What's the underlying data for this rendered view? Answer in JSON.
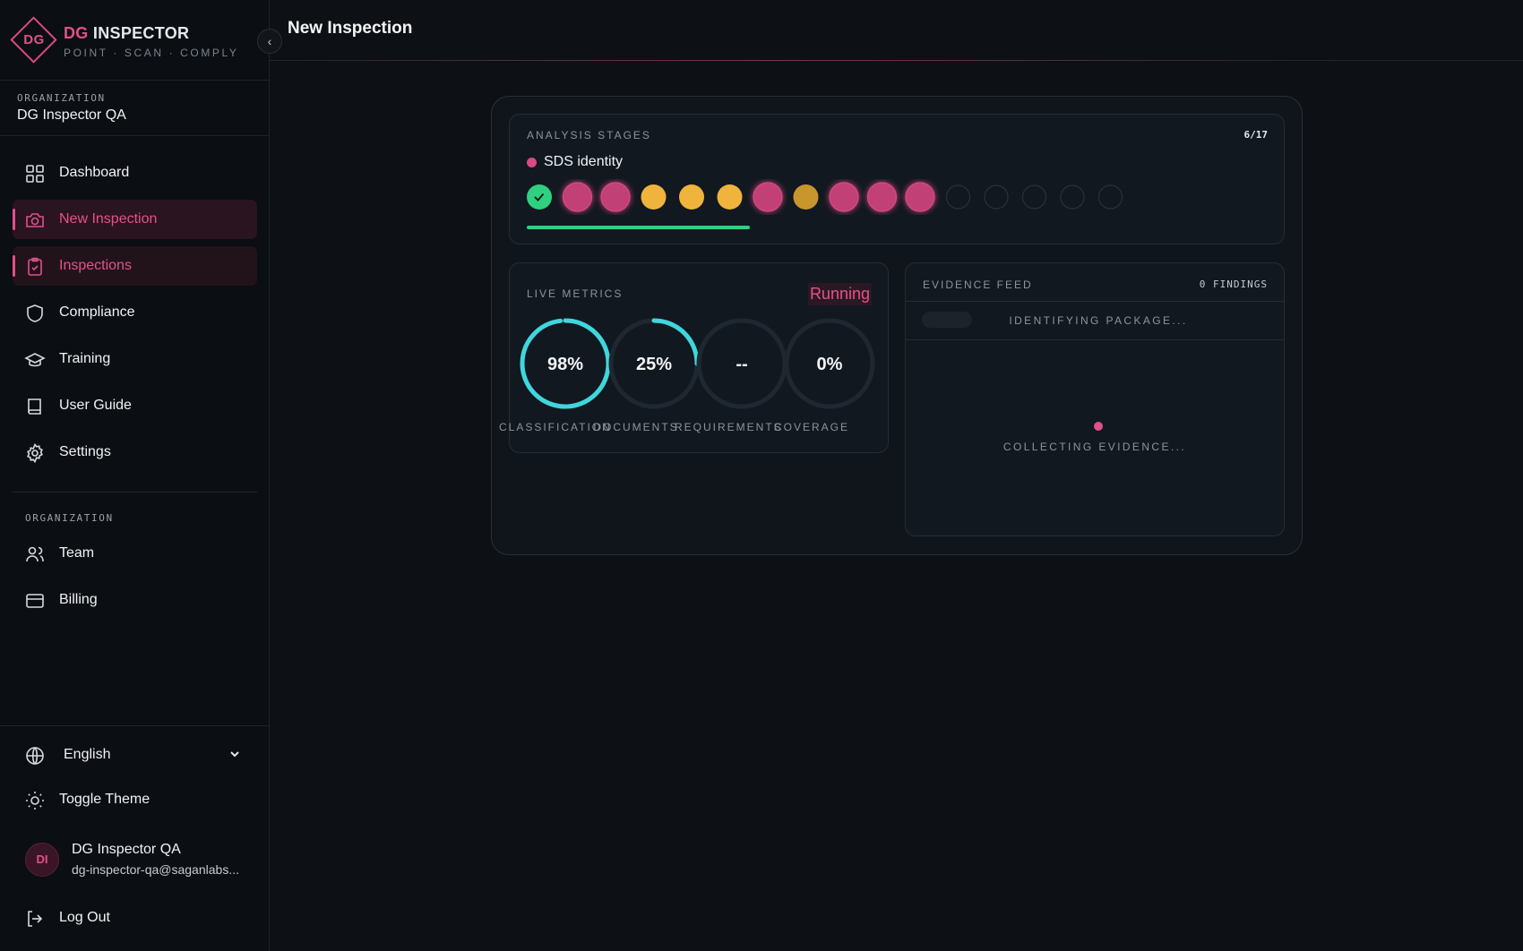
{
  "brand": {
    "logo_text": "DG",
    "title_accent": "DG",
    "title_rest": " INSPECTOR",
    "tagline": "POINT · SCAN · COMPLY"
  },
  "sidebar": {
    "organization_label": "ORGANIZATION",
    "organization_name": "DG Inspector QA",
    "items": [
      {
        "label": "Dashboard",
        "icon": "grid-icon",
        "active": false
      },
      {
        "label": "New Inspection",
        "icon": "camera-icon",
        "active": true
      },
      {
        "label": "Inspections",
        "icon": "clipboard-check-icon",
        "active": true
      },
      {
        "label": "Compliance",
        "icon": "shield-icon",
        "active": false
      },
      {
        "label": "Training",
        "icon": "graduation-cap-icon",
        "active": false
      },
      {
        "label": "User Guide",
        "icon": "book-icon",
        "active": false
      },
      {
        "label": "Settings",
        "icon": "gear-icon",
        "active": false
      }
    ],
    "org_section_label": "ORGANIZATION",
    "org_items": [
      {
        "label": "Team",
        "icon": "users-icon"
      },
      {
        "label": "Billing",
        "icon": "credit-card-icon"
      }
    ],
    "language": "English",
    "toggle_theme": "Toggle Theme",
    "user": {
      "initials": "DI",
      "name": "DG Inspector QA",
      "email": "dg-inspector-qa@saganlabs..."
    },
    "logout": "Log Out"
  },
  "header": {
    "title": "New Inspection"
  },
  "analysis": {
    "label": "ANALYSIS STAGES",
    "count": "6/17",
    "current_stage": "SDS identity",
    "progress": 0.353,
    "stages": [
      "done",
      "active",
      "active",
      "warn",
      "warn",
      "warn",
      "active",
      "warn-dim",
      "active",
      "active",
      "active",
      "pending",
      "pending",
      "pending",
      "pending",
      "pending"
    ]
  },
  "metrics": {
    "label": "LIVE METRICS",
    "status": "Running",
    "gauges": [
      {
        "value_text": "98%",
        "label": "CLASSIFICATION",
        "fraction": 0.98
      },
      {
        "value_text": "25%",
        "label": "DOCUMENTS",
        "fraction": 0.25
      },
      {
        "value_text": "--",
        "label": "REQUIREMENTS",
        "fraction": 0
      },
      {
        "value_text": "0%",
        "label": "COVERAGE",
        "fraction": 0
      }
    ]
  },
  "evidence": {
    "label": "EVIDENCE FEED",
    "findings": "0 FINDINGS",
    "status": "IDENTIFYING PACKAGE...",
    "empty_text": "COLLECTING EVIDENCE..."
  },
  "colors": {
    "accent": "#e0508c",
    "success": "#2fd07f",
    "warning": "#f0b43c",
    "gauge": "#3fd6dc"
  }
}
